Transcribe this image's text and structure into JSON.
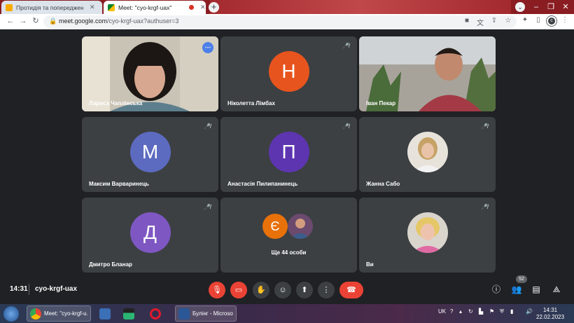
{
  "browser": {
    "tabs": [
      {
        "title": "Протидія та попередження бу",
        "active": false
      },
      {
        "title": "Meet: \"cyo-krgf-uax\"",
        "active": true
      }
    ],
    "new_tab": "+",
    "url_host": "meet.google.com",
    "url_path": "/cyo-krgf-uax?authuser=3",
    "profile_initial": "c"
  },
  "participants": [
    {
      "name": "Лариса Чаплінська",
      "type": "video",
      "muted": false,
      "speaking": true
    },
    {
      "name": "Ніколетта Лімбах",
      "type": "initial",
      "initial": "Н",
      "color": "#e8541e",
      "muted": true
    },
    {
      "name": "Іван Пекар",
      "type": "video",
      "muted": false
    },
    {
      "name": "Максим Варваринець",
      "type": "initial",
      "initial": "М",
      "color": "#5c6bc0",
      "muted": true
    },
    {
      "name": "Анастасія Пилипанинець",
      "type": "initial",
      "initial": "П",
      "color": "#5e35b1",
      "muted": true
    },
    {
      "name": "Жанна Сабо",
      "type": "photo",
      "muted": true
    },
    {
      "name": "Дмитро Бланар",
      "type": "initial",
      "initial": "Д",
      "color": "#7e57c2",
      "muted": true
    },
    {
      "name": "Ще 44 особи",
      "type": "others",
      "initial": "Є",
      "color": "#e8710a"
    },
    {
      "name": "Ви",
      "type": "photo",
      "muted": true
    }
  ],
  "meeting": {
    "time": "14:31",
    "code": "cyo-krgf-uax",
    "participant_count": "52"
  },
  "taskbar": {
    "items": [
      {
        "label": "Meet: \"cyo-krgf-u...",
        "open": true
      },
      {
        "label": "Булінг - Microsof...",
        "open": true
      }
    ],
    "lang": "UK",
    "clock_time": "14:31",
    "clock_date": "22.02.2023"
  }
}
